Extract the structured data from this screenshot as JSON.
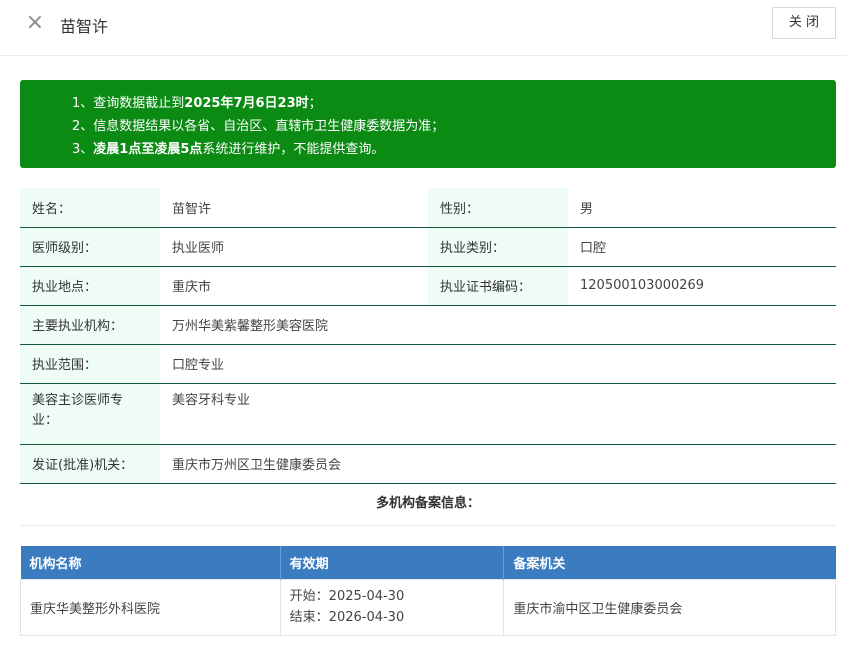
{
  "header": {
    "close_icon": "×",
    "title": "苗智许",
    "close_label": "关 闭"
  },
  "notice": {
    "line1_pre": "1、查询数据截止到",
    "line1_bold": "2025年7月6日23时",
    "line1_post": "；",
    "line2": "2、信息数据结果以各省、自治区、直辖市卫生健康委数据为准；",
    "line3_pre": "3、",
    "line3_bold": "凌晨1点至凌晨5点",
    "line3_post": "系统进行维护，不能提供查询。"
  },
  "info": {
    "name_label": "姓名：",
    "name_value": "苗智许",
    "gender_label": "性别：",
    "gender_value": "男",
    "level_label": "医师级别：",
    "level_value": "执业医师",
    "category_label": "执业类别：",
    "category_value": "口腔",
    "location_label": "执业地点：",
    "location_value": "重庆市",
    "cert_label": "执业证书编码：",
    "cert_value": "120500103000269",
    "org_label": "主要执业机构：",
    "org_value": "万州华美紫馨整形美容医院",
    "scope_label": "执业范围：",
    "scope_value": "口腔专业",
    "cosmetic_label": "美容主诊医师专业：",
    "cosmetic_value": "美容牙科专业",
    "authority_label": "发证(批准)机关：",
    "authority_value": "重庆市万州区卫生健康委员会"
  },
  "multi": {
    "title": "多机构备案信息："
  },
  "org_table": {
    "headers": [
      "机构名称",
      "有效期",
      "备案机关"
    ],
    "rows": [
      {
        "name": "重庆华美整形外科医院",
        "start": "开始：2025-04-30",
        "end": "结束：2026-04-30",
        "authority": "重庆市渝中区卫生健康委员会"
      }
    ]
  }
}
